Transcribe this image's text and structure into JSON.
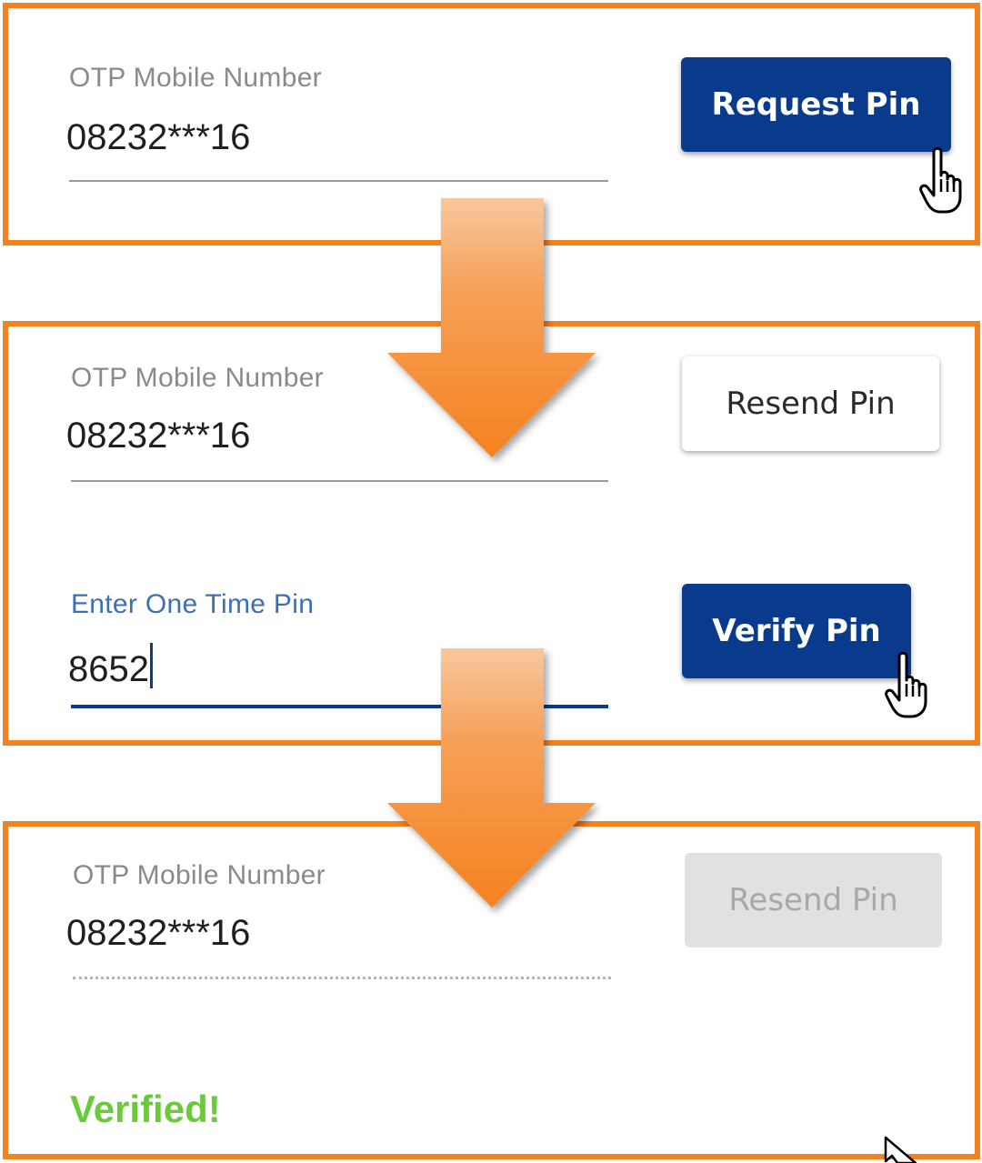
{
  "step1": {
    "mobile_label": "OTP Mobile Number",
    "mobile_value": "08232***16",
    "request_button": "Request Pin"
  },
  "step2": {
    "mobile_label": "OTP Mobile Number",
    "mobile_value": "08232***16",
    "resend_button": "Resend Pin",
    "pin_label": "Enter One Time Pin",
    "pin_value": "8652",
    "verify_button": "Verify Pin"
  },
  "step3": {
    "mobile_label": "OTP Mobile Number",
    "mobile_value": "08232***16",
    "resend_button": "Resend Pin",
    "status_text": "Verified!"
  },
  "colors": {
    "frame": "#f58220",
    "primary_button": "#0a3a8c",
    "verified": "#6acb3a",
    "focus_label": "#3d6fb5"
  },
  "icons": [
    "hand-pointer-icon",
    "arrow-pointer-icon",
    "down-arrow-icon"
  ]
}
